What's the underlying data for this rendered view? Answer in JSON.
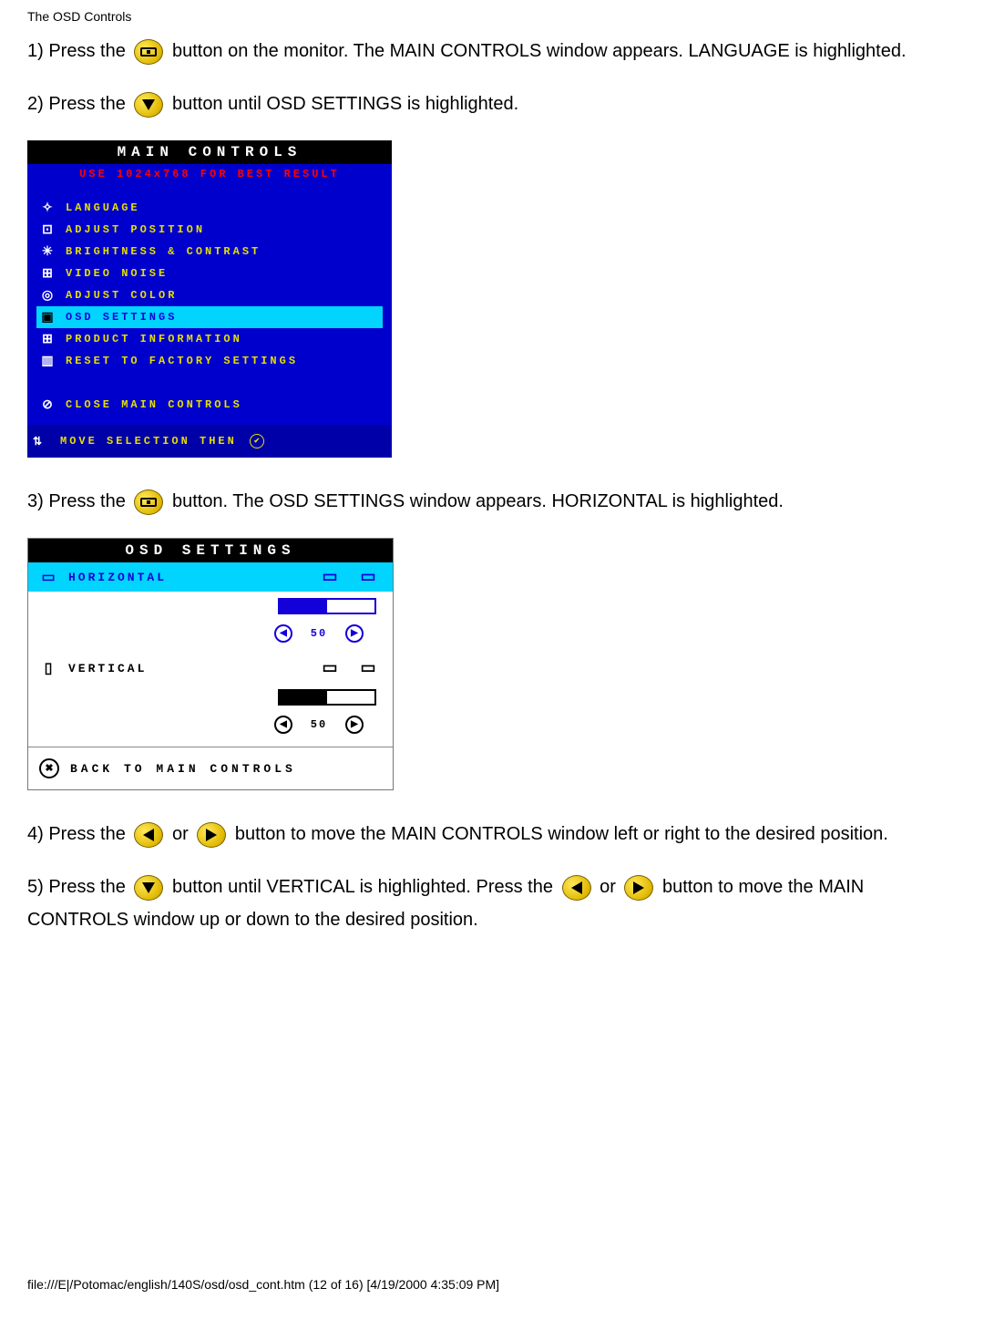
{
  "header": "The OSD Controls",
  "icons": {
    "ok": "OK",
    "down": "▼",
    "left": "◀",
    "right": "▶"
  },
  "steps": {
    "s1a": "1) Press the ",
    "s1b": " button on the monitor. The MAIN CONTROLS window appears. LANGUAGE is highlighted.",
    "s2a": "2) Press the ",
    "s2b": " button until OSD SETTINGS is highlighted.",
    "s3a": "3) Press the ",
    "s3b": " button. The OSD SETTINGS window appears. HORIZONTAL is highlighted.",
    "s4a": "4) Press the ",
    "s4b": " or ",
    "s4c": " button to move the MAIN CONTROLS window left or right to the desired position.",
    "s5a": "5) Press the ",
    "s5b": " button until VERTICAL is highlighted. Press the ",
    "s5c": " or ",
    "s5d": " button to move the MAIN CONTROLS window up or down to the desired position."
  },
  "main_controls": {
    "title": "MAIN CONTROLS",
    "hint": "USE 1024x768 FOR BEST RESULT",
    "items": [
      {
        "icon": "✧",
        "label": "LANGUAGE",
        "selected": false
      },
      {
        "icon": "⊡",
        "label": "ADJUST POSITION",
        "selected": false
      },
      {
        "icon": "✳",
        "label": "BRIGHTNESS & CONTRAST",
        "selected": false
      },
      {
        "icon": "⊞",
        "label": "VIDEO NOISE",
        "selected": false
      },
      {
        "icon": "◎",
        "label": "ADJUST COLOR",
        "selected": false
      },
      {
        "icon": "▣",
        "label": "OSD SETTINGS",
        "selected": true
      },
      {
        "icon": "⊞",
        "label": "PRODUCT INFORMATION",
        "selected": false
      },
      {
        "icon": "▥",
        "label": "RESET TO FACTORY SETTINGS",
        "selected": false
      }
    ],
    "close": {
      "icon": "⊘",
      "label": "CLOSE MAIN CONTROLS"
    },
    "footer": "MOVE SELECTION THEN"
  },
  "osd_settings": {
    "title": "OSD SETTINGS",
    "horizontal": {
      "label": "HORIZONTAL",
      "value": 50,
      "selected": true
    },
    "vertical": {
      "label": "VERTICAL",
      "value": 50,
      "selected": false
    },
    "back": "BACK TO MAIN CONTROLS"
  },
  "footer": "file:///E|/Potomac/english/140S/osd/osd_cont.htm (12 of 16) [4/19/2000 4:35:09 PM]"
}
